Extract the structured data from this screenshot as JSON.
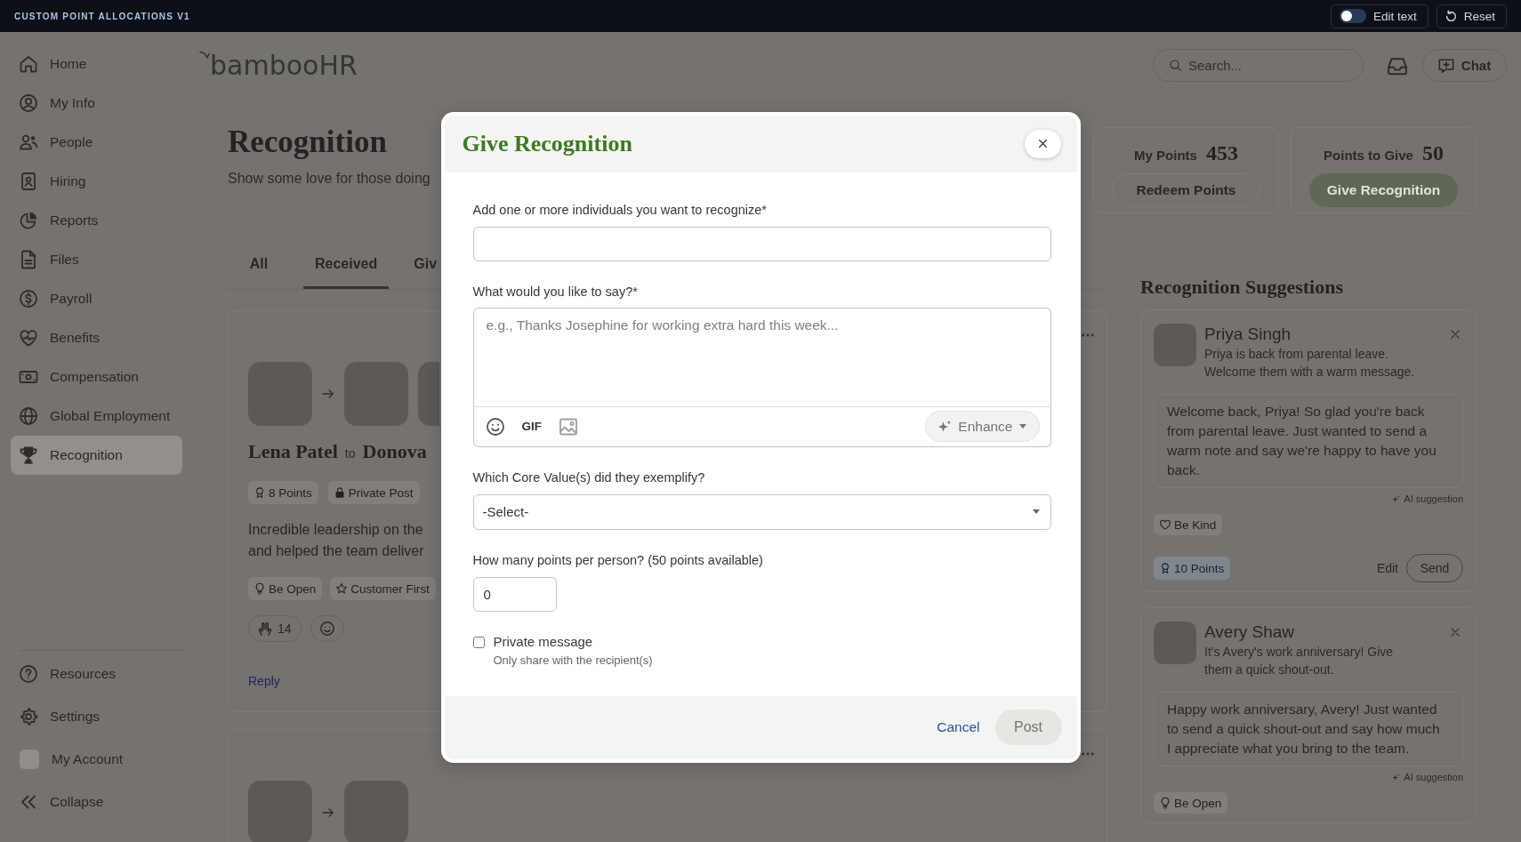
{
  "top_bar": {
    "title": "CUSTOM POINT ALLOCATIONS V1",
    "edit_toggle": {
      "label": "Edit text",
      "on": false
    },
    "reset": "Reset"
  },
  "sidebar": {
    "items": [
      {
        "label": "Home",
        "selected": false
      },
      {
        "label": "My Info",
        "selected": false
      },
      {
        "label": "People",
        "selected": false
      },
      {
        "label": "Hiring",
        "selected": false
      },
      {
        "label": "Reports",
        "selected": false
      },
      {
        "label": "Files",
        "selected": false
      },
      {
        "label": "Payroll",
        "selected": false
      },
      {
        "label": "Benefits",
        "selected": false
      },
      {
        "label": "Compensation",
        "selected": false
      },
      {
        "label": "Global Employment",
        "selected": false
      },
      {
        "label": "Recognition",
        "selected": true
      }
    ],
    "footer_items": [
      {
        "label": "Resources"
      },
      {
        "label": "Settings"
      },
      {
        "label": "My Account"
      },
      {
        "label": "Collapse"
      }
    ]
  },
  "header": {
    "logo": "bambooHR",
    "search": {
      "placeholder": "Search..."
    },
    "chat": "Chat"
  },
  "page": {
    "title": "Recognition",
    "subtitle": "Show some love for those doing"
  },
  "points": [
    {
      "label": "My Points",
      "value": "453",
      "button": "Redeem Points",
      "kind": "secondary"
    },
    {
      "label": "Points to Give",
      "value": "50",
      "button": "Give Recognition",
      "kind": "primary"
    }
  ],
  "tabs": [
    {
      "label": "All",
      "selected": false
    },
    {
      "label": "Received",
      "selected": true
    },
    {
      "label": "Giv",
      "selected": false
    }
  ],
  "feed": [
    {
      "sender": "Lena Patel",
      "connector": "to",
      "recipient": "Donova",
      "badges": [
        "8 Points",
        "Private Post"
      ],
      "message": [
        "Incredible leadership on the",
        "and helped the team deliver"
      ],
      "values": [
        "Be Open",
        "Customer First"
      ],
      "reactions": "14",
      "reply": "Reply"
    }
  ],
  "suggestions": {
    "title": "Recognition Suggestions",
    "items": [
      {
        "name": "Priya Singh",
        "reason": "Priya is back from parental leave. Welcome them with a warm message.",
        "message": "Welcome back, Priya! So glad you're back from parental leave. Just wanted to send a warm note and say we're happy to have you back.",
        "ai_note": "AI suggestion",
        "value": "Be Kind",
        "points": "10 Points",
        "edit": "Edit",
        "send": "Send"
      },
      {
        "name": "Avery Shaw",
        "reason": "It's Avery's work anniversary! Give them a quick shout-out.",
        "message": "Happy work anniversary, Avery! Just wanted to send a quick shout-out and say how much I appreciate what you bring to the team.",
        "ai_note": "AI suggestion",
        "value": "Be Open"
      }
    ]
  },
  "modal": {
    "title": "Give Recognition",
    "fields": [
      {
        "kind": "people",
        "label": "Add one or more individuals you want to recognize*"
      },
      {
        "kind": "message",
        "label": "What would you like to say?*",
        "placeholder": "e.g., Thanks Josephine for working extra hard this week...",
        "gif": "GIF",
        "enhance": {
          "label": "Enhance",
          "disabled": true
        }
      },
      {
        "kind": "select",
        "label": "Which Core Value(s) did they exemplify?",
        "value": "-Select-"
      },
      {
        "kind": "number",
        "label": "How many points per person? (50 points available)",
        "value": "0"
      },
      {
        "kind": "checkbox",
        "label": "Private message",
        "hint": "Only share with the recipient(s)",
        "checked": false
      }
    ],
    "cancel": "Cancel",
    "post": {
      "label": "Post",
      "disabled": true
    }
  }
}
